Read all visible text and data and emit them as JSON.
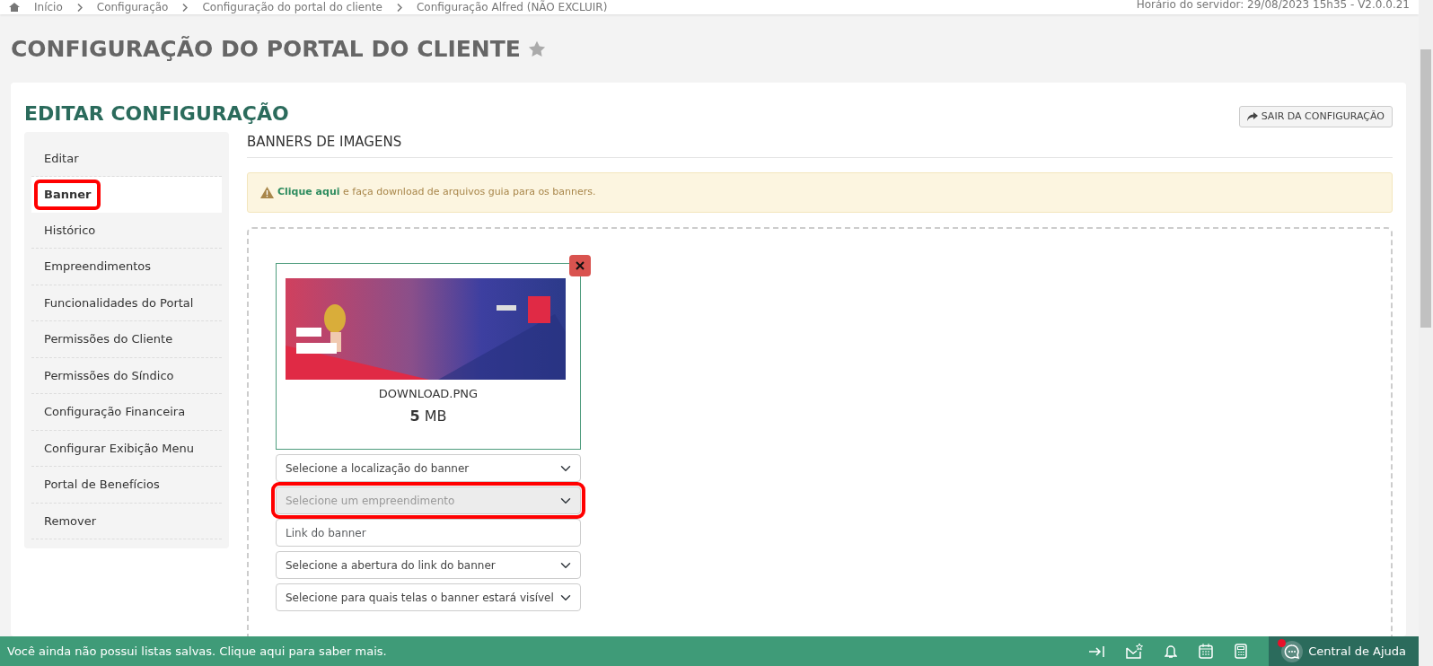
{
  "breadcrumb": {
    "items": [
      "Início",
      "Configuração",
      "Configuração do portal do cliente",
      "Configuração Alfred (NÃO EXCLUIR)"
    ],
    "server_info": "Horário do servidor: 29/08/2023 15h35 - V2.0.0.21"
  },
  "page_title": "CONFIGURAÇÃO DO PORTAL DO CLIENTE",
  "favorite": false,
  "card_title": "EDITAR CONFIGURAÇÃO",
  "exit_button": "SAIR DA CONFIGURAÇÃO",
  "sidebar": {
    "items": [
      {
        "label": "Editar",
        "selected": false,
        "highlighted": false
      },
      {
        "label": "Banner",
        "selected": true,
        "highlighted": true
      },
      {
        "label": "Histórico",
        "selected": false,
        "highlighted": false
      },
      {
        "label": "Empreendimentos",
        "selected": false,
        "highlighted": false
      },
      {
        "label": "Funcionalidades do Portal",
        "selected": false,
        "highlighted": false
      },
      {
        "label": "Permissões do Cliente",
        "selected": false,
        "highlighted": false
      },
      {
        "label": "Permissões do Síndico",
        "selected": false,
        "highlighted": false
      },
      {
        "label": "Configuração Financeira",
        "selected": false,
        "highlighted": false
      },
      {
        "label": "Configurar Exibição Menu",
        "selected": false,
        "highlighted": false
      },
      {
        "label": "Portal de Benefícios",
        "selected": false,
        "highlighted": false
      },
      {
        "label": "Remover",
        "selected": false,
        "highlighted": false
      }
    ]
  },
  "section_title": "BANNERS DE IMAGENS",
  "alert": {
    "link": "Clique aqui",
    "text": "e faça download de arquivos guia para os banners."
  },
  "banner": {
    "file_name": "DOWNLOAD.PNG",
    "size_value": "5",
    "size_unit": "MB",
    "fields": [
      {
        "kind": "select",
        "text": "Selecione a localização do banner",
        "disabled": false,
        "highlighted": false
      },
      {
        "kind": "select",
        "text": "Selecione um empreendimento",
        "disabled": true,
        "highlighted": true
      },
      {
        "kind": "input",
        "placeholder": "Link do banner",
        "disabled": false,
        "highlighted": false
      },
      {
        "kind": "select",
        "text": "Selecione a abertura do link do banner",
        "disabled": false,
        "highlighted": false
      },
      {
        "kind": "select",
        "text": "Selecione para quais telas o banner estará visível",
        "disabled": false,
        "highlighted": false
      }
    ]
  },
  "footer": {
    "message": "Você ainda não possui listas salvas. Clique aqui para saber mais.",
    "help": "Central de Ajuda",
    "help_notification": true
  }
}
